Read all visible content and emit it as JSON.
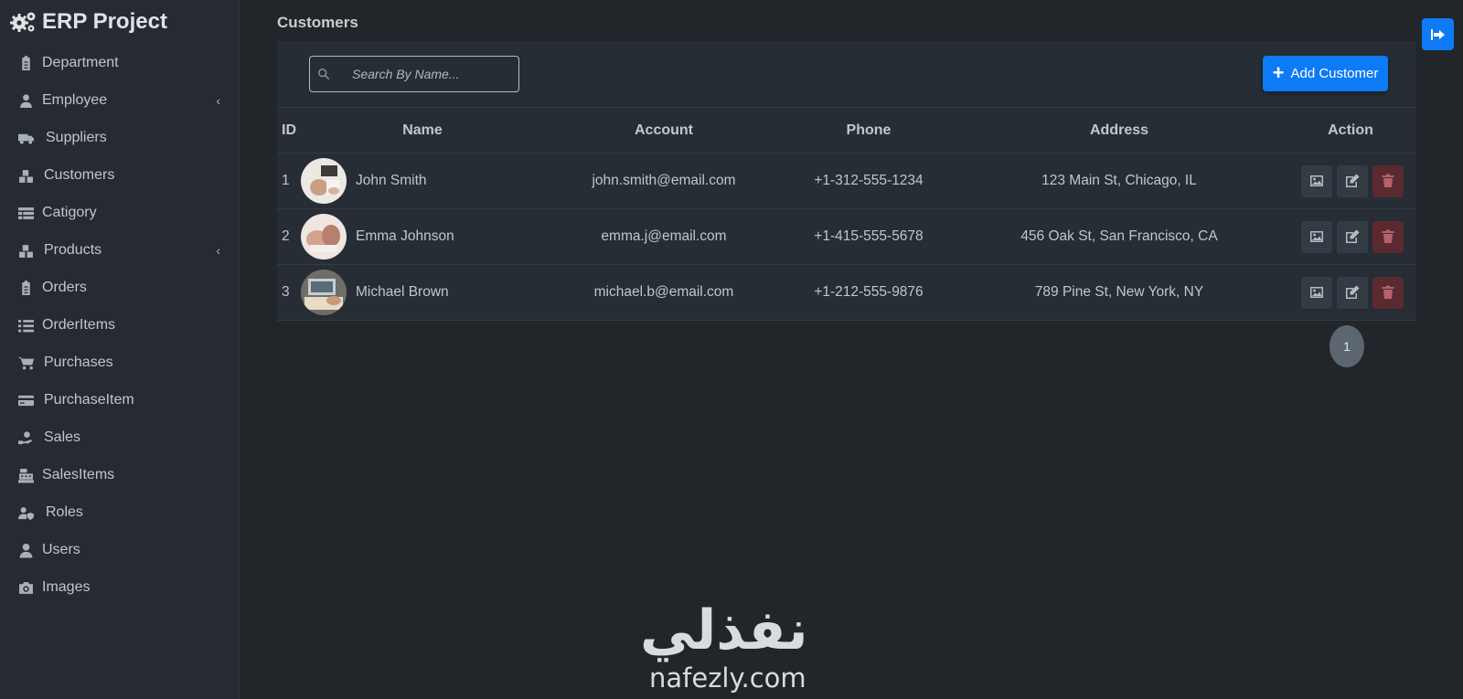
{
  "app": {
    "title": "ERP Project"
  },
  "sidebar": {
    "items": [
      {
        "label": "Department",
        "icon": "clipboard-icon",
        "expandable": false
      },
      {
        "label": "Employee",
        "icon": "users-icon",
        "expandable": true
      },
      {
        "label": "Suppliers",
        "icon": "truck-icon",
        "expandable": false
      },
      {
        "label": "Customers",
        "icon": "boxes-icon",
        "expandable": false
      },
      {
        "label": "Catigory",
        "icon": "table-icon",
        "expandable": false
      },
      {
        "label": "Products",
        "icon": "boxes-icon",
        "expandable": true
      },
      {
        "label": "Orders",
        "icon": "clipboard-icon",
        "expandable": false
      },
      {
        "label": "OrderItems",
        "icon": "list-icon",
        "expandable": false
      },
      {
        "label": "Purchases",
        "icon": "cart-icon",
        "expandable": false
      },
      {
        "label": "PurchaseItem",
        "icon": "credit-card-icon",
        "expandable": false
      },
      {
        "label": "Sales",
        "icon": "hand-dollar-icon",
        "expandable": false
      },
      {
        "label": "SalesItems",
        "icon": "cash-register-icon",
        "expandable": false
      },
      {
        "label": "Roles",
        "icon": "user-shield-icon",
        "expandable": false
      },
      {
        "label": "Users",
        "icon": "user-icon",
        "expandable": false
      },
      {
        "label": "Images",
        "icon": "camera-icon",
        "expandable": false
      }
    ],
    "chevron": "‹"
  },
  "main": {
    "title": "Customers",
    "search": {
      "placeholder": "Search By Name..."
    },
    "add_button": {
      "label": "Add Customer"
    },
    "table": {
      "headers": {
        "id": "ID",
        "name": "Name",
        "account": "Account",
        "phone": "Phone",
        "address": "Address",
        "action": "Action"
      },
      "rows": [
        {
          "id": "1",
          "name": "John Smith",
          "account": "john.smith@email.com",
          "phone": "+1-312-555-1234",
          "address": "123 Main St, Chicago, IL"
        },
        {
          "id": "2",
          "name": "Emma Johnson",
          "account": "emma.j@email.com",
          "phone": "+1-415-555-5678",
          "address": "456 Oak St, San Francisco, CA"
        },
        {
          "id": "3",
          "name": "Michael Brown",
          "account": "michael.b@email.com",
          "phone": "+1-212-555-9876",
          "address": "789 Pine St, New York, NY"
        }
      ]
    },
    "pagination": {
      "current": "1"
    }
  },
  "watermark": {
    "arabic": "نفذلي",
    "latin": "nafezly.com"
  },
  "colors": {
    "accent": "#0d7bf5",
    "danger_bg": "#5a2a30",
    "background": "#22262b",
    "sidebar": "#262b31"
  }
}
